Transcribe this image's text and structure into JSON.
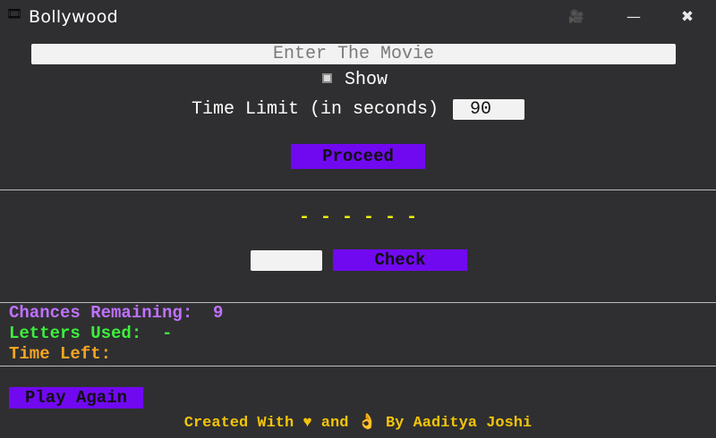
{
  "window": {
    "title": "Bollywood",
    "app_icon": "film-reel-icon",
    "camera_icon": "video-camera-icon",
    "minimize_glyph": "—",
    "close_glyph": "✖"
  },
  "movie_entry": {
    "placeholder": "Enter The Movie",
    "value": ""
  },
  "show": {
    "label": "Show",
    "checked": false
  },
  "time_limit": {
    "label": "Time Limit (in seconds)",
    "value": "90"
  },
  "buttons": {
    "proceed": "Proceed",
    "check": "Check",
    "play_again": "Play Again"
  },
  "puzzle": {
    "blanks": "- - - - - -"
  },
  "guess": {
    "value": ""
  },
  "status": {
    "chances_label": "Chances Remaining:",
    "chances_value": "9",
    "letters_label": "Letters Used:",
    "letters_value": "-",
    "time_left_label": "Time Left:",
    "time_left_value": ""
  },
  "footer": {
    "credit": "Created With ♥ and 👌 By Aaditya Joshi"
  },
  "colors": {
    "background": "#2f2f31",
    "button_purple": "#7109f0",
    "blanks_yellow": "#f2f20a",
    "chances_purple": "#c071ff",
    "letters_green": "#3cf03c",
    "time_orange": "#f5a623",
    "footer_gold": "#f2c40a"
  }
}
